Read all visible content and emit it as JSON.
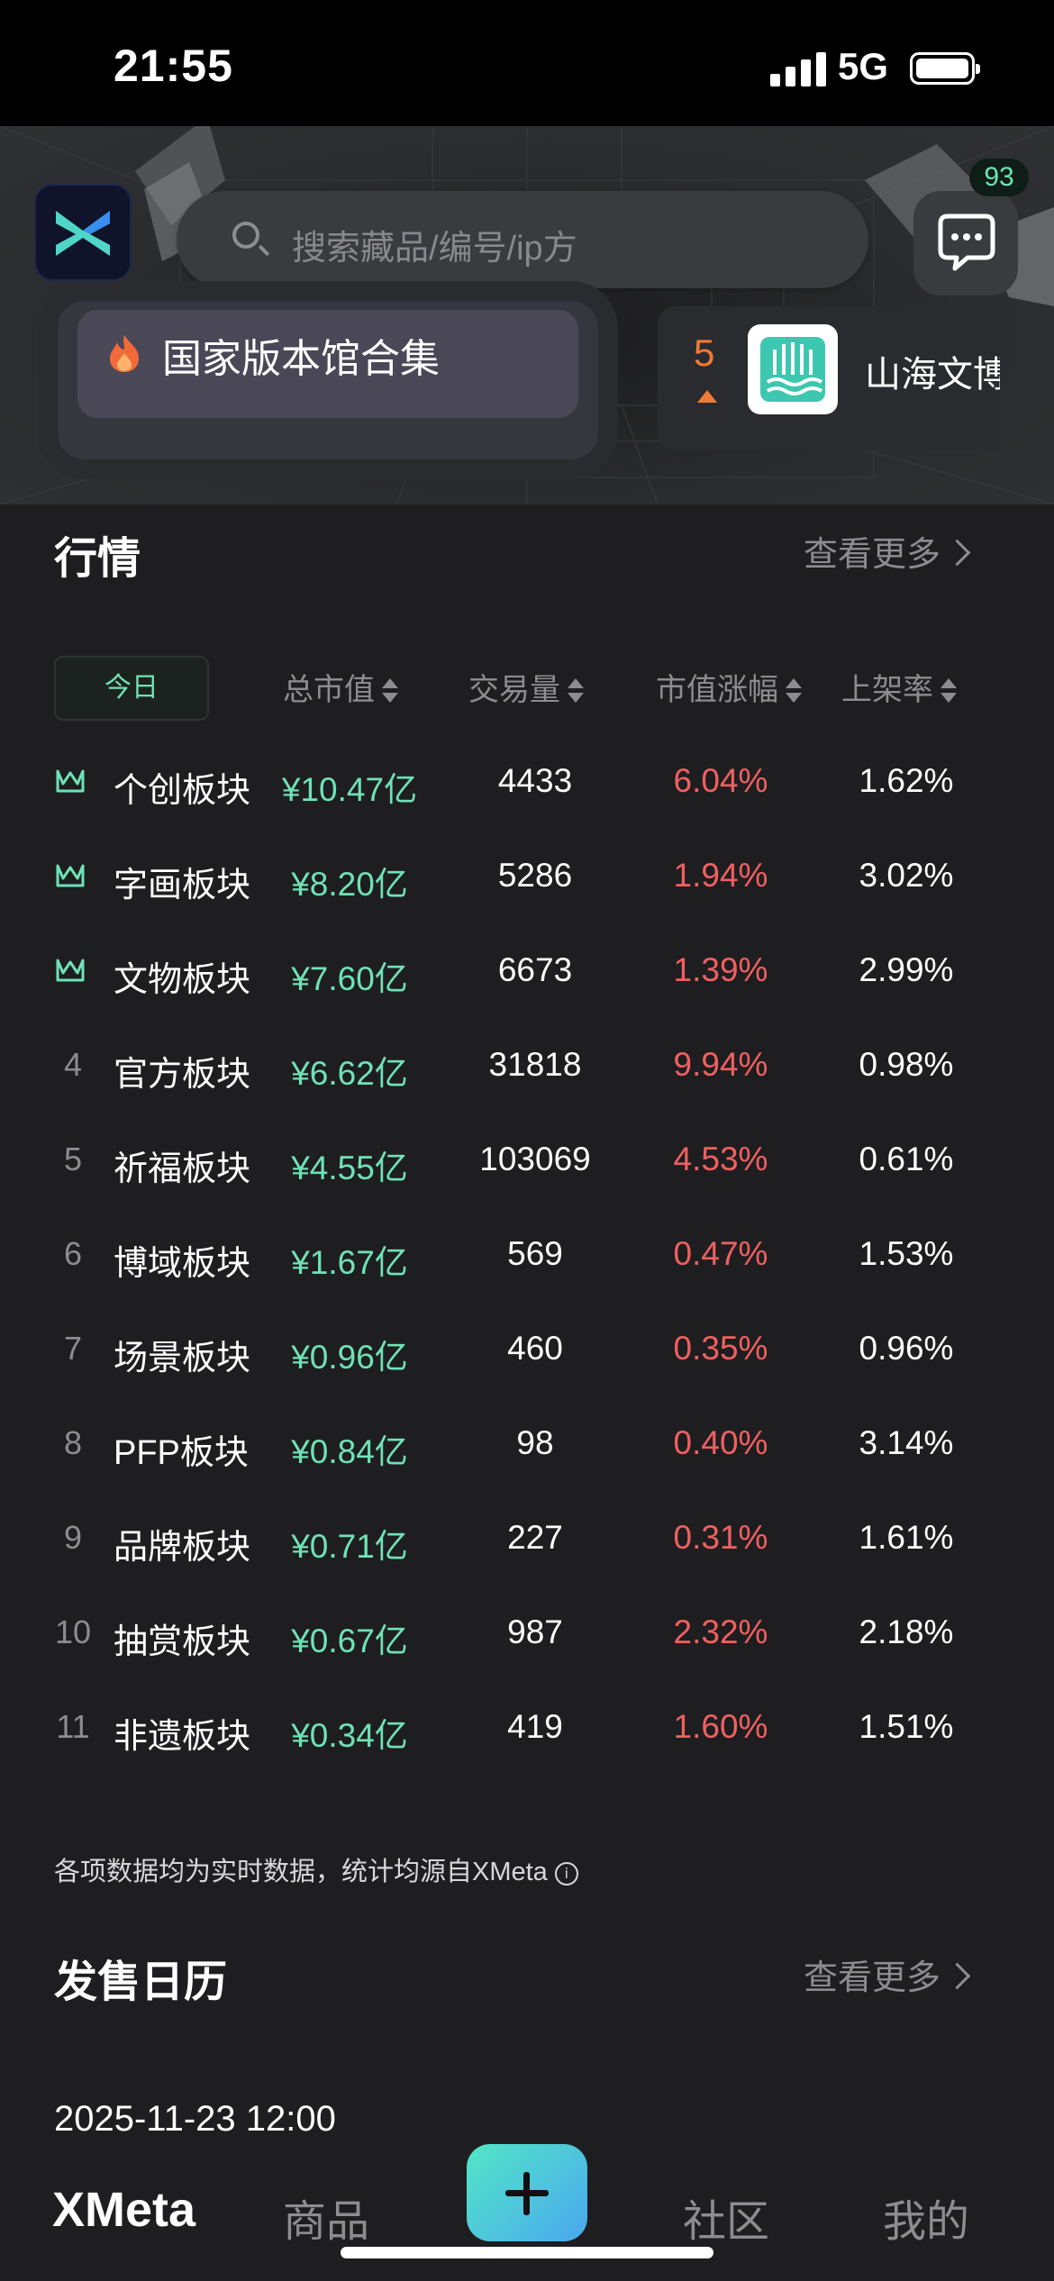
{
  "status_bar": {
    "time": "21:55",
    "network": "5G"
  },
  "header": {
    "search_placeholder": "搜索藏品/编号/ip方",
    "message_badge": "93"
  },
  "featured": {
    "title": "国家版本馆合集",
    "rank_number": "5",
    "rank_name": "山海文博"
  },
  "market": {
    "title": "行情",
    "see_more": "查看更多",
    "today_tab": "今日",
    "columns": [
      "总市值",
      "交易量",
      "市值涨幅",
      "上架率"
    ],
    "rows": [
      {
        "rank": "1",
        "name": "个创板块",
        "cap": "¥10.47亿",
        "volume": "4433",
        "change": "6.04%",
        "rate": "1.62%"
      },
      {
        "rank": "2",
        "name": "字画板块",
        "cap": "¥8.20亿",
        "volume": "5286",
        "change": "1.94%",
        "rate": "3.02%"
      },
      {
        "rank": "3",
        "name": "文物板块",
        "cap": "¥7.60亿",
        "volume": "6673",
        "change": "1.39%",
        "rate": "2.99%"
      },
      {
        "rank": "4",
        "name": "官方板块",
        "cap": "¥6.62亿",
        "volume": "31818",
        "change": "9.94%",
        "rate": "0.98%"
      },
      {
        "rank": "5",
        "name": "祈福板块",
        "cap": "¥4.55亿",
        "volume": "103069",
        "change": "4.53%",
        "rate": "0.61%"
      },
      {
        "rank": "6",
        "name": "博域板块",
        "cap": "¥1.67亿",
        "volume": "569",
        "change": "0.47%",
        "rate": "1.53%"
      },
      {
        "rank": "7",
        "name": "场景板块",
        "cap": "¥0.96亿",
        "volume": "460",
        "change": "0.35%",
        "rate": "0.96%"
      },
      {
        "rank": "8",
        "name": "PFP板块",
        "cap": "¥0.84亿",
        "volume": "98",
        "change": "0.40%",
        "rate": "3.14%"
      },
      {
        "rank": "9",
        "name": "品牌板块",
        "cap": "¥0.71亿",
        "volume": "227",
        "change": "0.31%",
        "rate": "1.61%"
      },
      {
        "rank": "10",
        "name": "抽赏板块",
        "cap": "¥0.67亿",
        "volume": "987",
        "change": "2.32%",
        "rate": "2.18%"
      },
      {
        "rank": "11",
        "name": "非遗板块",
        "cap": "¥0.34亿",
        "volume": "419",
        "change": "1.60%",
        "rate": "1.51%"
      }
    ],
    "disclaimer": "各项数据均为实时数据，统计均源自XMeta"
  },
  "calendar": {
    "title": "发售日历",
    "see_more": "查看更多",
    "first_date": "2025-11-23 12:00"
  },
  "tabbar": {
    "home": "XMeta",
    "goods": "商品",
    "community": "社区",
    "mine": "我的"
  },
  "colors": {
    "accent": "#6fe2b6",
    "negative": "#f06060",
    "rank_orange": "#f07a35",
    "background": "#1e1e20"
  }
}
